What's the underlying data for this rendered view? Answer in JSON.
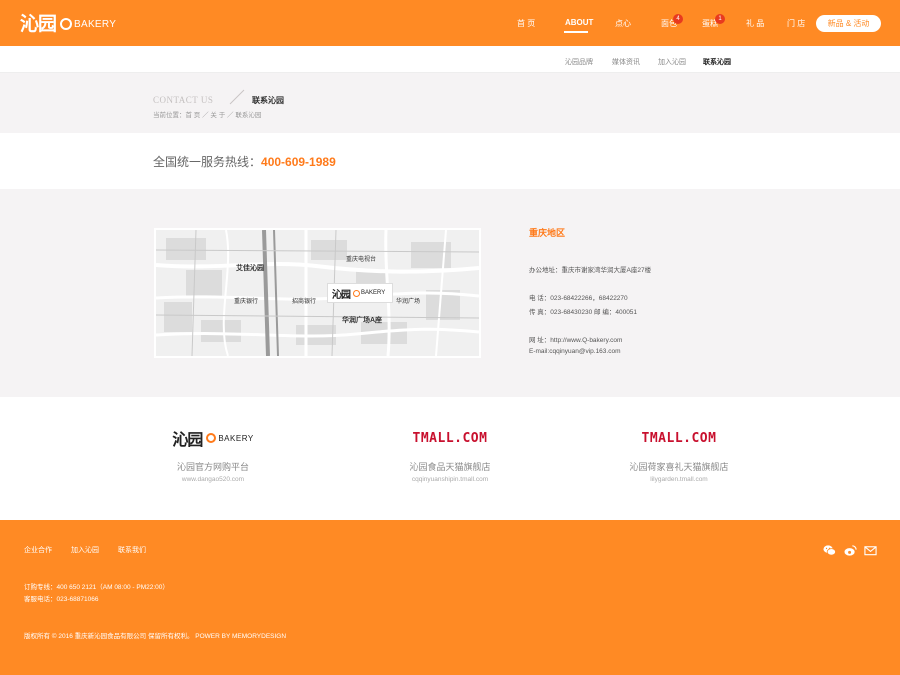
{
  "header": {
    "logo_mark": "沁园",
    "logo_text": "BAKERY",
    "nav": [
      {
        "label": "首 页"
      },
      {
        "label": "ABOUT"
      },
      {
        "label": "点心"
      },
      {
        "label": "面包",
        "badge": "4"
      },
      {
        "label": "蛋糕",
        "badge": "1"
      },
      {
        "label": "礼 品"
      },
      {
        "label": "门 店"
      }
    ],
    "cta_label": "新品 & 活动"
  },
  "subnav": [
    "沁园品牌",
    "媒体资讯",
    "加入沁园",
    "联系沁园"
  ],
  "title": {
    "en": "CONTACT US",
    "cn": "联系沁园",
    "breadcrumb": "当前位置：首 页  ／  关 于  ／  联系沁园"
  },
  "hotline": {
    "label": "全国统一服务热线：",
    "number": "400-609-1989"
  },
  "map": {
    "logo_mark": "沁园",
    "logo_text": "BAKERY",
    "labels": [
      "华润广场A座",
      "艾佳沁园",
      "重庆银行",
      "华润广场",
      "招商银行",
      "重庆电视台"
    ]
  },
  "contact": {
    "region": "重庆地区",
    "address": "办公地址：重庆市谢家湾华润大厦A座27楼",
    "phone": "电  话：023-68422266，68422270",
    "fax": "传  真：023-68430230       邮  编：400051",
    "website": "网  址：http://www.Q-bakery.com",
    "email": "E-mail:cqqinyuan@vip.163.com"
  },
  "stores": [
    {
      "logo": "沁园",
      "logo_text": "BAKERY",
      "name": "沁园官方网购平台",
      "url": "www.dangao520.com"
    },
    {
      "logo": "TMALL.COM",
      "name": "沁园食品天猫旗舰店",
      "url": "cqqinyuanshipin.tmall.com"
    },
    {
      "logo": "TMALL.COM",
      "name": "沁园荷家喜礼天猫旗舰店",
      "url": "lilygarden.tmall.com"
    }
  ],
  "footer": {
    "links": [
      "企业合作",
      "加入沁园",
      "联系我们"
    ],
    "order_line": "订购专线：400 650 2121（AM 08:00 - PM22:00）",
    "service_line": "客服电话：023-68871066",
    "copyright": "版权所有 © 2016 重庆新沁园食品有限公司 保留所有权利。  POWER BY MEMORYDESIGN",
    "icons": [
      "wechat-icon",
      "weibo-icon",
      "mail-icon"
    ]
  },
  "colors": {
    "brand_orange": "#ff8a24",
    "accent_orange": "#ff7a1a",
    "tmall_red": "#c8102e"
  }
}
